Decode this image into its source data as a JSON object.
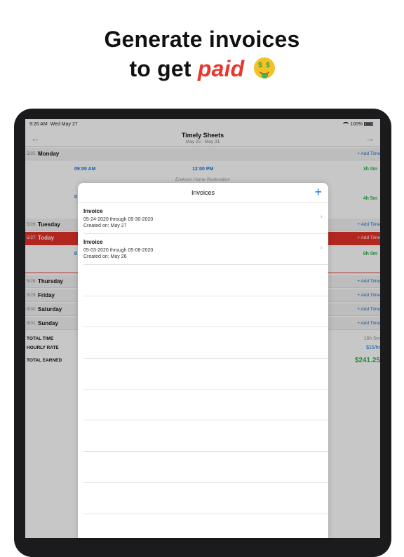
{
  "promo": {
    "line1": "Generate invoices",
    "line2_prefix": "to get",
    "line2_accent": "paid",
    "emoji_icon": "money-mouth-face-icon",
    "accent_color": "#e8372c"
  },
  "status_bar": {
    "time": "9:26 AM",
    "date": "Wed May 27",
    "battery": "100%"
  },
  "nav": {
    "title": "Timely Sheets",
    "subtitle": "May 25 - May 31"
  },
  "days": [
    {
      "date": "5/25",
      "name": "Monday",
      "add": "+ Add Time"
    },
    {
      "date": "5/26",
      "name": "Tuesday",
      "add": "+ Add Time"
    },
    {
      "date": "5/27",
      "name": "Today",
      "add": "+ Add Time"
    },
    {
      "date": "5/28",
      "name": "Thursday",
      "add": "+ Add Time"
    },
    {
      "date": "5/29",
      "name": "Friday",
      "add": "+ Add Time"
    },
    {
      "date": "5/30",
      "name": "Saturday",
      "add": "+ Add Time"
    },
    {
      "date": "5/31",
      "name": "Sunday",
      "add": "+ Add Time"
    }
  ],
  "entries": [
    {
      "start": "09:00 AM",
      "end": "12:00 PM",
      "client": "Erekson Home Restoration",
      "duration": "3h 0m"
    },
    {
      "start": "0",
      "end": "",
      "client": "",
      "duration": "4h 5m"
    },
    {
      "start": "0",
      "end": "",
      "client": "",
      "duration": "9h 0m"
    }
  ],
  "summary": {
    "total_time_label": "TOTAL TIME",
    "total_time": "16h 5m",
    "hourly_rate_label": "HOURLY RATE",
    "hourly_rate": "$15/hr",
    "total_earned_label": "TOTAL EARNED",
    "total_earned": "$241.25"
  },
  "modal": {
    "title": "Invoices",
    "add_label": "+",
    "invoices": [
      {
        "title": "Invoice",
        "range": "05-24-2020 through 05-30-2020",
        "created": "Created on: May 27"
      },
      {
        "title": "Invoice",
        "range": "05-03-2020 through 05-08-2020",
        "created": "Created on: May 26"
      }
    ]
  },
  "colors": {
    "link_blue": "#1a73d9",
    "today_red": "#e53228",
    "earned_green": "#2db24a"
  }
}
